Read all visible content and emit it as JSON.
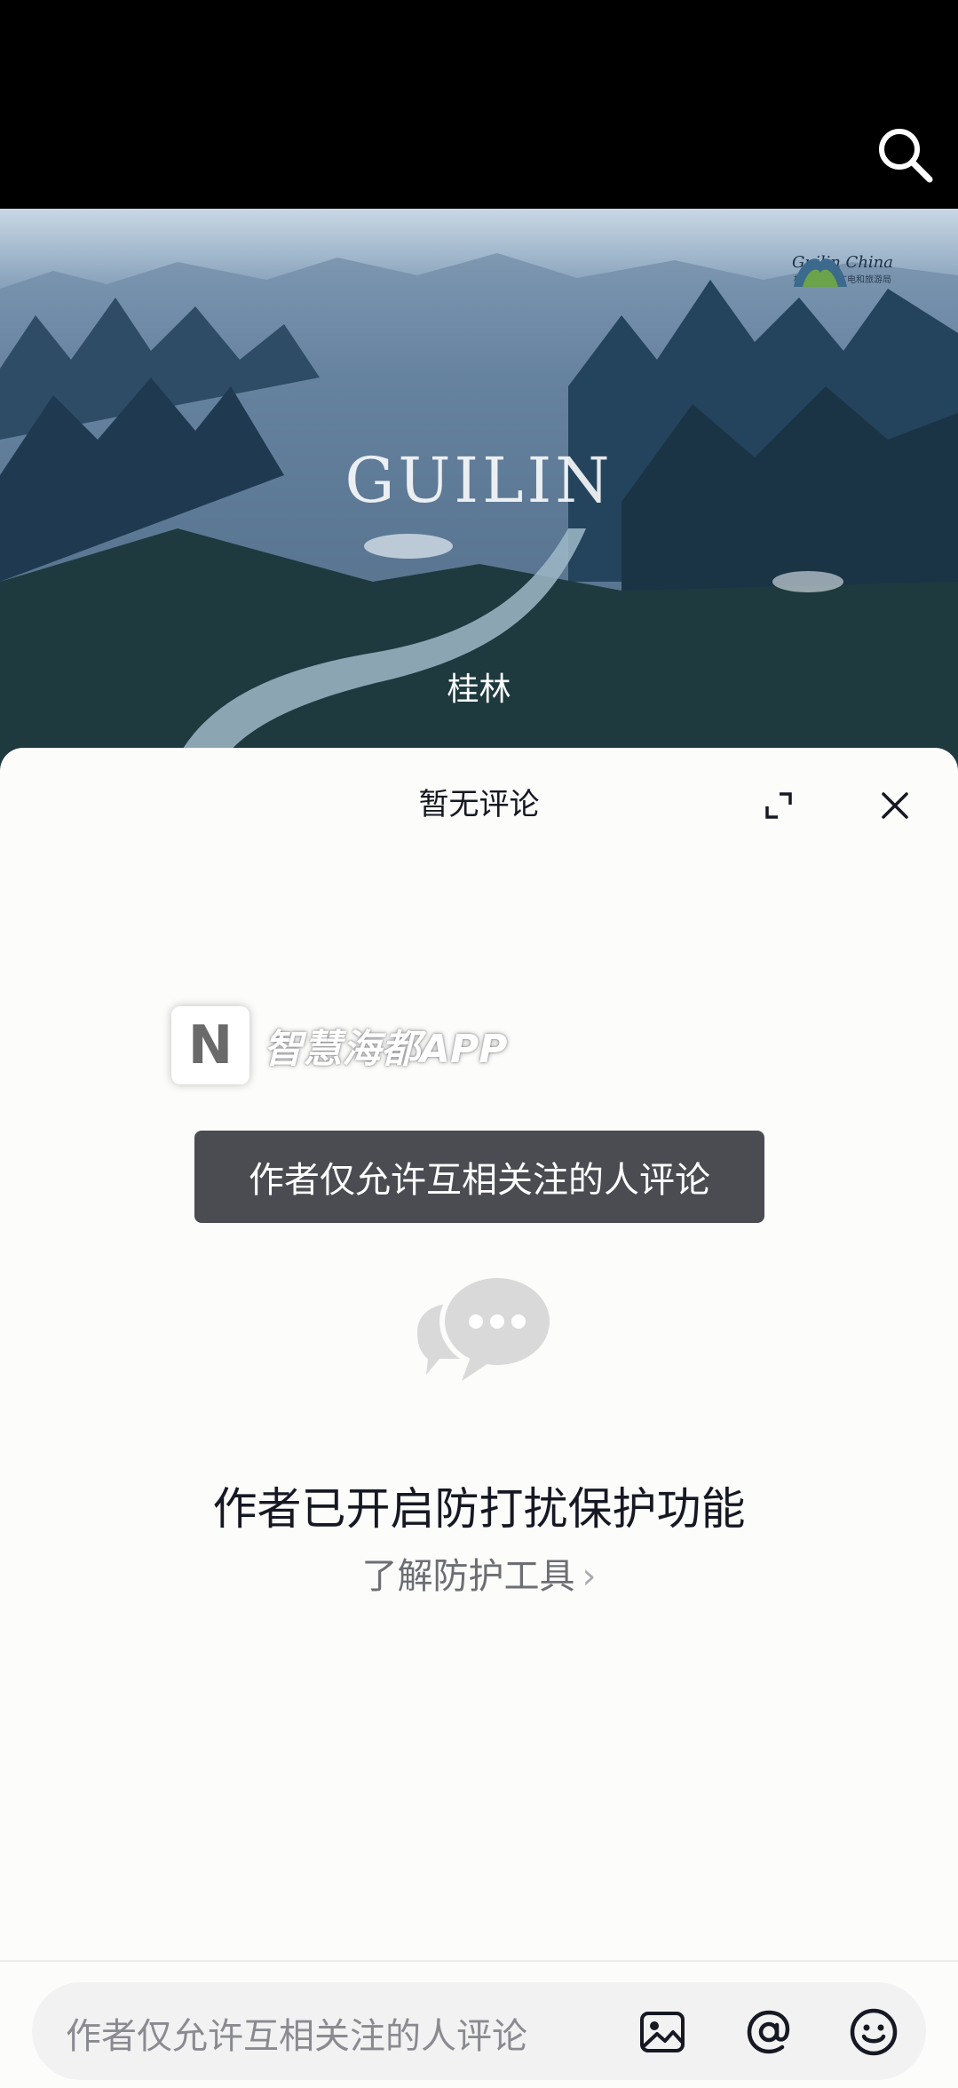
{
  "hero": {
    "title": "GUILIN",
    "subtitle": "桂林",
    "logo_text": "Guilin China",
    "logo_small": "桂林市文化广电和旅游局"
  },
  "sheet": {
    "title": "暂无评论",
    "watermark_badge": "N",
    "watermark_text": "智慧海都APP",
    "toast": "作者仅允许互相关注的人评论",
    "protect_title": "作者已开启防打扰保护功能",
    "learn_link": "了解防护工具",
    "learn_chevron": "›"
  },
  "input": {
    "placeholder": "作者仅允许互相关注的人评论"
  },
  "icons": {
    "search": "search-icon",
    "expand": "expand-icon",
    "close": "close-icon",
    "comment": "comment-bubbles-icon",
    "image": "image-icon",
    "at": "at-icon",
    "emoji": "emoji-icon"
  }
}
